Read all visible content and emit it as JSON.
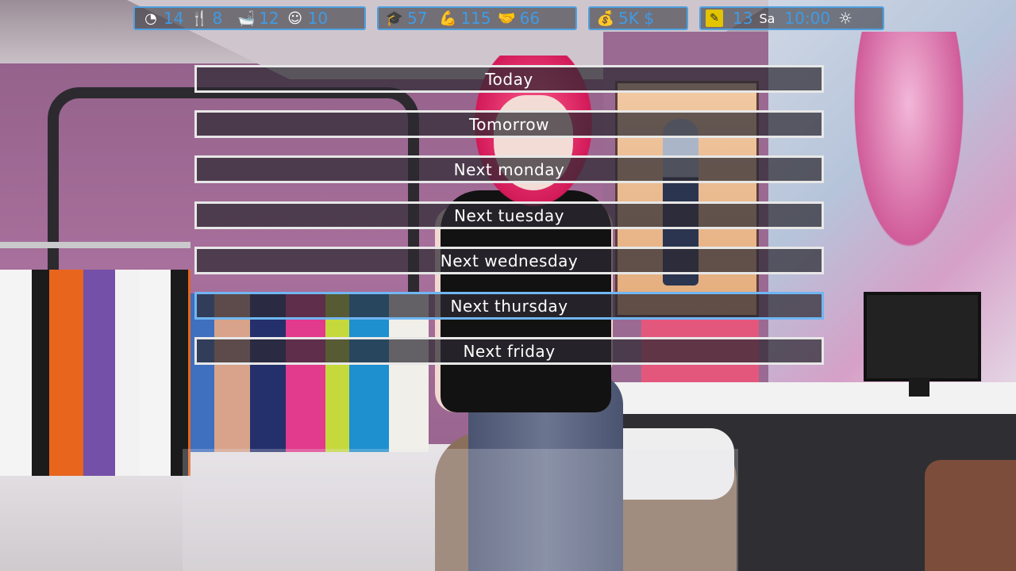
{
  "hud": {
    "stats_group_1": [
      {
        "icon": "energy-gauge-icon",
        "glyph": "◔",
        "value": "14"
      },
      {
        "icon": "fork-knife-icon",
        "glyph": "🍴",
        "value": "8"
      },
      {
        "icon": "bathtub-icon",
        "glyph": "🛁",
        "value": "12"
      },
      {
        "icon": "theater-mask-icon",
        "glyph": "☺",
        "value": "10"
      }
    ],
    "stats_group_2": [
      {
        "icon": "graduation-cap-icon",
        "glyph": "🎓",
        "value": "57"
      },
      {
        "icon": "flexed-arm-icon",
        "glyph": "💪",
        "value": "115"
      },
      {
        "icon": "handshake-icon",
        "glyph": "🤝",
        "value": "66"
      }
    ],
    "money": {
      "icon": "money-bag-icon",
      "glyph": "💰",
      "value": "5K $"
    },
    "calendar": {
      "icon": "note-icon",
      "glyph": "✎",
      "day_number": "13",
      "weekday": "Sa",
      "time": "10:00",
      "weather_icon": "sun-icon",
      "weather_glyph": "☼"
    }
  },
  "menu": {
    "options": [
      "Today",
      "Tomorrow",
      "Next monday",
      "Next tuesday",
      "Next wednesday",
      "Next thursday",
      "Next friday"
    ],
    "highlighted": "Next thursday"
  },
  "colors": {
    "hud_accent": "#3e9be6",
    "hover_border": "#70b6f2",
    "button_border": "#e7e7e7"
  }
}
